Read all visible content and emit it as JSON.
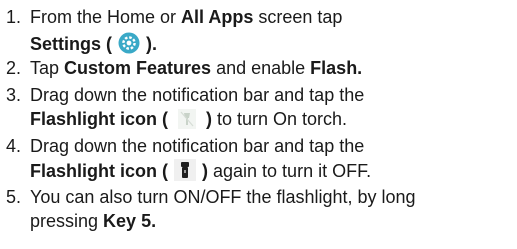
{
  "steps": [
    {
      "number": "1.",
      "line1": "From the Home or ",
      "line1_bold": "All Apps",
      "line1_end": " screen tap",
      "line2_bold_a": "Settings ( ",
      "line2_bold_b": " ).",
      "icon": "settings-gear-icon",
      "icon_color": "#3aa9c7"
    },
    {
      "number": "2.",
      "text_a": "Tap ",
      "bold_a": "Custom Features",
      "text_b": " and enable ",
      "bold_b": "Flash."
    },
    {
      "number": "3.",
      "line1": "Drag down the notification bar and tap the",
      "line2_bold_a": "Flashlight icon (",
      "line2_bold_b": ")",
      "line2_end": " to turn On torch.",
      "icon": "flashlight-off-icon"
    },
    {
      "number": "4.",
      "line1": "Drag down the notification bar and tap the",
      "line2_bold_a": "Flashlight icon (",
      "line2_bold_b": ")",
      "line2_end": " again to turn it OFF.",
      "icon": "flashlight-on-icon"
    },
    {
      "number": "5.",
      "line1": "You can also turn ON/OFF the flashlight, by long",
      "line2": "pressing ",
      "line2_bold": "Key 5."
    }
  ]
}
